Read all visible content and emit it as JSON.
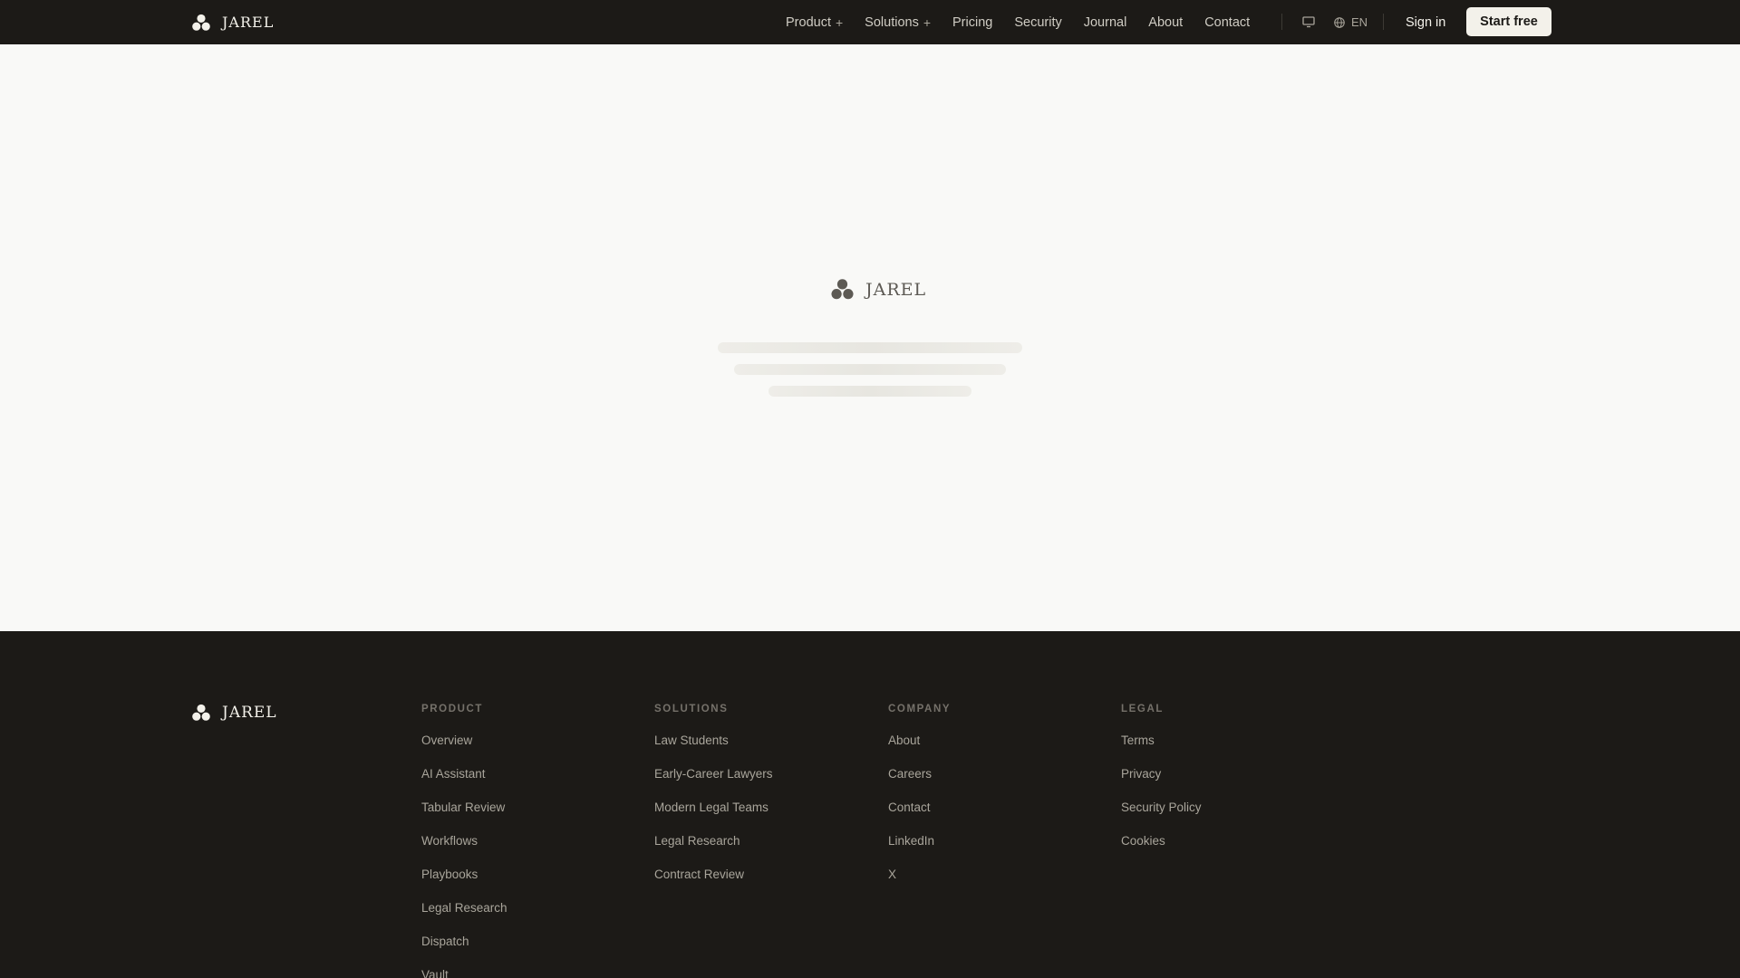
{
  "brand": {
    "name": "JAREL"
  },
  "header": {
    "nav": [
      {
        "label": "Product",
        "expandable": true
      },
      {
        "label": "Solutions",
        "expandable": true
      },
      {
        "label": "Pricing",
        "expandable": false
      },
      {
        "label": "Security",
        "expandable": false
      },
      {
        "label": "Journal",
        "expandable": false
      },
      {
        "label": "About",
        "expandable": false
      },
      {
        "label": "Contact",
        "expandable": false
      }
    ],
    "expand_glyph": "+",
    "language": "EN",
    "sign_in": "Sign in",
    "cta": "Start free",
    "icons": {
      "display": "monitor-icon",
      "language": "globe-icon",
      "logo": "tri-leaf-logo-icon"
    }
  },
  "loader": {
    "wordmark": "JAREL"
  },
  "footer": {
    "columns": [
      {
        "heading": "PRODUCT",
        "links": [
          "Overview",
          "AI Assistant",
          "Tabular Review",
          "Workflows",
          "Playbooks",
          "Legal Research",
          "Dispatch",
          "Vault"
        ]
      },
      {
        "heading": "SOLUTIONS",
        "links": [
          "Law Students",
          "Early-Career Lawyers",
          "Modern Legal Teams",
          "Legal Research",
          "Contract Review"
        ]
      },
      {
        "heading": "COMPANY",
        "links": [
          "About",
          "Careers",
          "Contact",
          "LinkedIn",
          "X"
        ]
      },
      {
        "heading": "LEGAL",
        "links": [
          "Terms",
          "Privacy",
          "Security Policy",
          "Cookies"
        ]
      }
    ]
  },
  "colors": {
    "header_bg": "#1c1a17",
    "page_bg": "#f9f9f7",
    "footer_bg": "#1c1a17",
    "cta_bg": "#f3f1ea",
    "nav_text": "#cfccc3",
    "footer_link": "#a9a59b",
    "footer_heading": "#75716a"
  }
}
